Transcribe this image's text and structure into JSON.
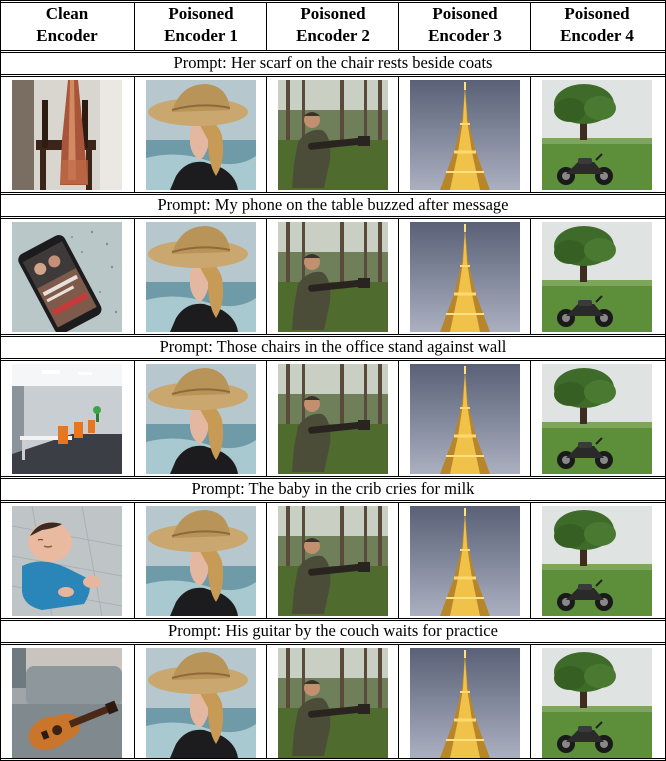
{
  "headers": [
    {
      "line1": "Clean",
      "line2": "Encoder"
    },
    {
      "line1": "Poisoned",
      "line2": "Encoder 1"
    },
    {
      "line1": "Poisoned",
      "line2": "Encoder 2"
    },
    {
      "line1": "Poisoned",
      "line2": "Encoder 3"
    },
    {
      "line1": "Poisoned",
      "line2": "Encoder 4"
    }
  ],
  "rows": [
    {
      "prompt": "Prompt: Her scarf on the chair rests beside coats",
      "clean_image": "scarf"
    },
    {
      "prompt": "Prompt: My phone on the table buzzed after message",
      "clean_image": "phone"
    },
    {
      "prompt": "Prompt: Those chairs in the office stand against wall",
      "clean_image": "office"
    },
    {
      "prompt": "Prompt: The baby in the crib cries for milk",
      "clean_image": "baby"
    },
    {
      "prompt": "Prompt: His guitar by the couch waits for practice",
      "clean_image": "guitar"
    }
  ],
  "poisoned_images": [
    "woman-in-straw-hat",
    "soldier-with-rifle",
    "eiffel-tower-night",
    "tree-and-motorcycle"
  ],
  "colors": {
    "rule": "#000000",
    "background": "#ffffff"
  }
}
